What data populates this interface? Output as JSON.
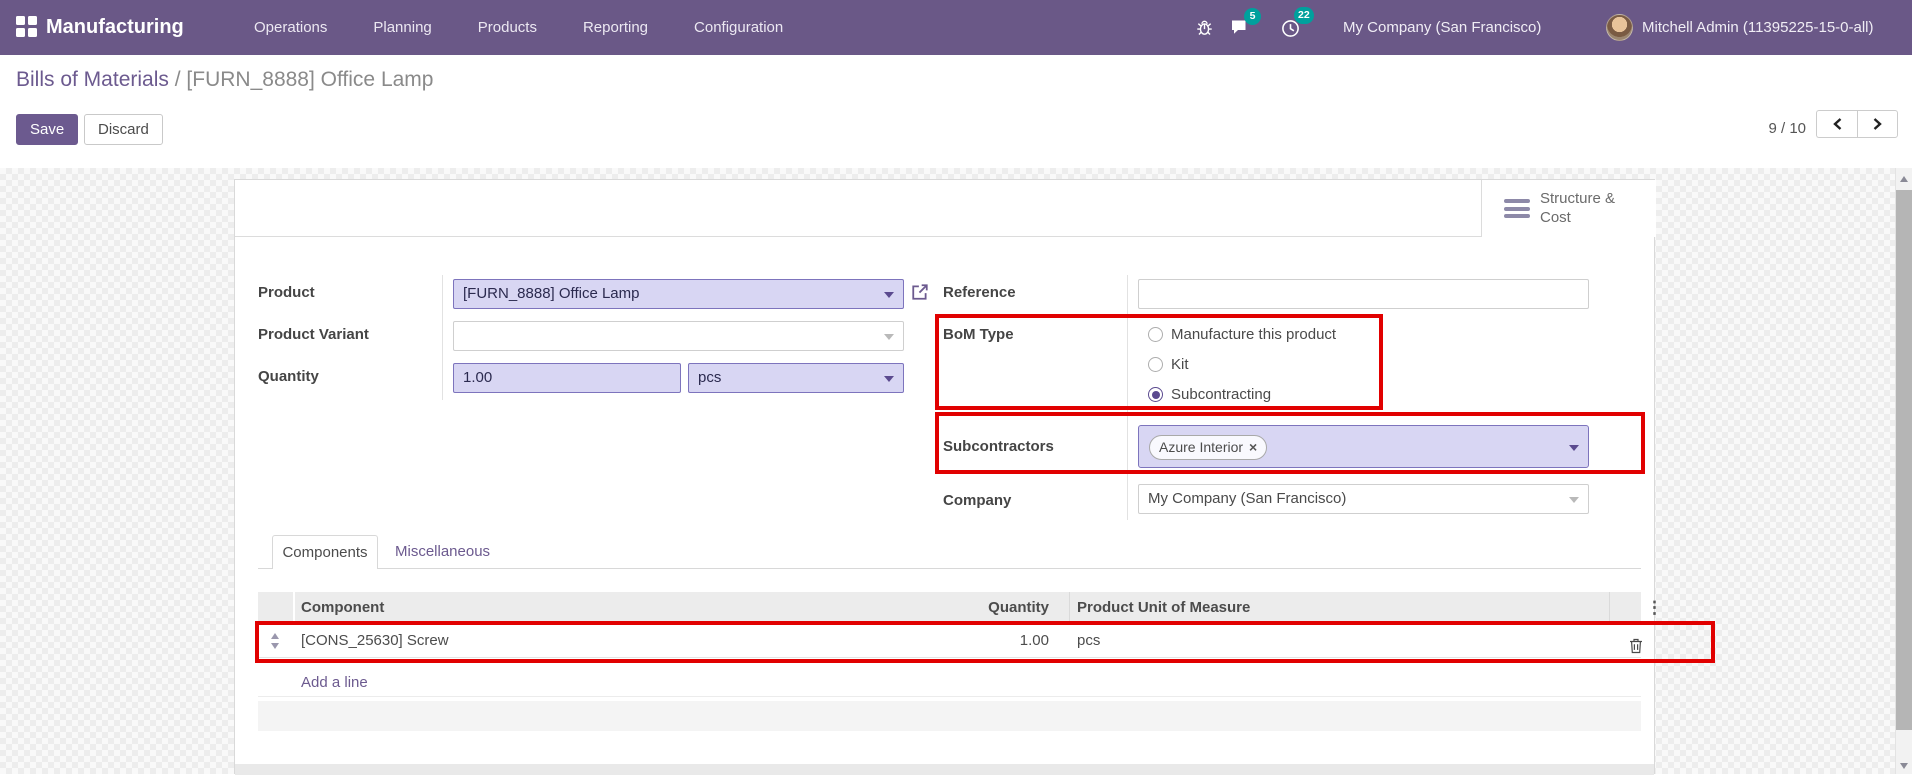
{
  "colors": {
    "navbar": "#6A5887",
    "accent": "#6C5A8F",
    "badge": "#00A09D",
    "highlight": "#E10000",
    "field_highlight": "#D8D6F3"
  },
  "topbar": {
    "app_name": "Manufacturing",
    "menus": [
      "Operations",
      "Planning",
      "Products",
      "Reporting",
      "Configuration"
    ],
    "messages_badge": "5",
    "activities_badge": "22",
    "company": "My Company (San Francisco)",
    "user": "Mitchell Admin (11395225-15-0-all)"
  },
  "control_panel": {
    "breadcrumb_parent": "Bills of Materials",
    "breadcrumb_separator": "/",
    "breadcrumb_current": "[FURN_8888] Office Lamp",
    "save_label": "Save",
    "discard_label": "Discard",
    "pager_text": "9 / 10"
  },
  "sheet": {
    "structure_cost_line1": "Structure &",
    "structure_cost_line2": "Cost",
    "fields": {
      "product": {
        "label": "Product",
        "value": "[FURN_8888] Office Lamp"
      },
      "product_variant": {
        "label": "Product Variant",
        "value": ""
      },
      "quantity": {
        "label": "Quantity",
        "value": "1.00",
        "uom": "pcs"
      },
      "reference": {
        "label": "Reference",
        "value": ""
      },
      "bom_type": {
        "label": "BoM Type",
        "options": [
          "Manufacture this product",
          "Kit",
          "Subcontracting"
        ],
        "selected": "Subcontracting"
      },
      "subcontractors": {
        "label": "Subcontractors",
        "tag": "Azure Interior",
        "remove_symbol": "×"
      },
      "company": {
        "label": "Company",
        "value": "My Company (San Francisco)"
      }
    },
    "tabs": [
      {
        "label": "Components"
      },
      {
        "label": "Miscellaneous"
      }
    ],
    "table": {
      "columns": [
        "Component",
        "Quantity",
        "Product Unit of Measure"
      ],
      "rows": [
        {
          "component": "[CONS_25630] Screw",
          "quantity": "1.00",
          "uom": "pcs"
        }
      ],
      "add_line_label": "Add a line"
    }
  }
}
